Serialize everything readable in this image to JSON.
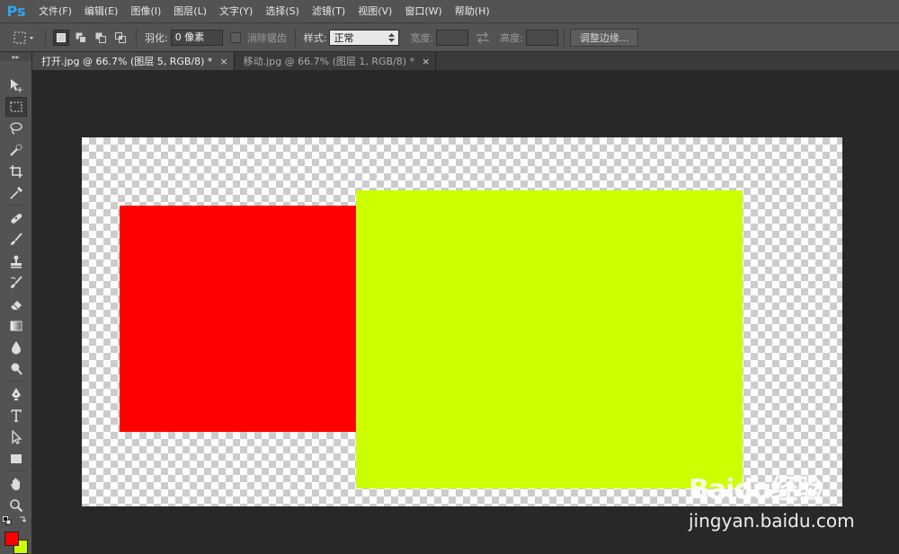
{
  "app": {
    "logo": "Ps"
  },
  "menu": [
    {
      "label": "文件(F)"
    },
    {
      "label": "编辑(E)"
    },
    {
      "label": "图像(I)"
    },
    {
      "label": "图层(L)"
    },
    {
      "label": "文字(Y)"
    },
    {
      "label": "选择(S)"
    },
    {
      "label": "滤镜(T)"
    },
    {
      "label": "视图(V)"
    },
    {
      "label": "窗口(W)"
    },
    {
      "label": "帮助(H)"
    }
  ],
  "options": {
    "feather_label": "羽化:",
    "feather_value": "0 像素",
    "antialias_label": "消除锯齿",
    "style_label": "样式:",
    "style_value": "正常",
    "width_label": "宽度:",
    "height_label": "高度:",
    "refine_edge_label": "调整边缘..."
  },
  "tabs": [
    {
      "label": "打开.jpg @ 66.7% (图层 5, RGB/8) *",
      "close": "×",
      "active": true
    },
    {
      "label": "移动.jpg @ 66.7% (图层 1, RGB/8) *",
      "close": "×",
      "active": false
    }
  ],
  "canvas": {
    "shapes": [
      {
        "name": "red-rectangle",
        "color": "#ff0000"
      },
      {
        "name": "yellow-green-rectangle",
        "color": "#ccff00"
      }
    ]
  },
  "colors": {
    "foreground": "#ff0000",
    "background": "#ccff00",
    "accent_logo": "#2fa6f0"
  },
  "watermark": {
    "logo": "Baidu经验",
    "url": "jingyan.baidu.com"
  },
  "tools": [
    {
      "icon": "move-tool-icon"
    },
    {
      "icon": "rectangular-marquee-tool-icon"
    },
    {
      "icon": "lasso-tool-icon"
    },
    {
      "icon": "quick-selection-tool-icon"
    },
    {
      "icon": "crop-tool-icon"
    },
    {
      "icon": "eyedropper-tool-icon"
    },
    {
      "icon": "spot-healing-brush-tool-icon"
    },
    {
      "icon": "brush-tool-icon"
    },
    {
      "icon": "clone-stamp-tool-icon"
    },
    {
      "icon": "history-brush-tool-icon"
    },
    {
      "icon": "eraser-tool-icon"
    },
    {
      "icon": "gradient-tool-icon"
    },
    {
      "icon": "blur-tool-icon"
    },
    {
      "icon": "dodge-tool-icon"
    },
    {
      "icon": "pen-tool-icon"
    },
    {
      "icon": "type-tool-icon"
    },
    {
      "icon": "path-selection-tool-icon"
    },
    {
      "icon": "rectangle-tool-icon"
    },
    {
      "icon": "hand-tool-icon"
    },
    {
      "icon": "zoom-tool-icon"
    }
  ]
}
